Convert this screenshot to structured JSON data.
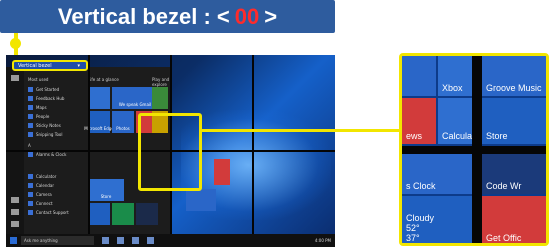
{
  "header": {
    "prefix": "Vertical bezel : <",
    "value": "00",
    "suffix": ">"
  },
  "screen": {
    "selected_label": "Vertical bezel",
    "start_menu": {
      "most_used_heading": "Most used",
      "most_used": [
        "Get Started",
        "Feedback Hub",
        "Maps",
        "People",
        "Sticky Notes",
        "Snipping Tool"
      ],
      "group_a_heading": "A",
      "group_a": [
        "Alarms & Clock"
      ],
      "lower_list": [
        "Calculator",
        "Calendar",
        "Camera",
        "Connect",
        "Contact Support"
      ],
      "tiles_group_top": "Life at a glance",
      "tiles_group_right": "Play and explore",
      "we_speak_gmail": "We speak Gmail",
      "tile_mail": "Mail",
      "tile_edge": "Microsoft Edge",
      "tile_photos": "Photos",
      "tile_xbox": "Xbox",
      "tile_store": "Store"
    },
    "taskbar": {
      "search_placeholder": "Ask me anything",
      "clock": "4:00 PM"
    }
  },
  "zoom": {
    "tiles": [
      "Xbox",
      "Groove Music",
      "ews",
      "Calcula",
      "Store",
      "s Clock",
      "Code Wr",
      "Cloudy",
      "52°",
      "37°",
      "Get Offic"
    ]
  },
  "colors": {
    "accent_highlight": "#f2e600",
    "header_bg": "#2e5c9e",
    "value_red": "#ff2b2b"
  }
}
